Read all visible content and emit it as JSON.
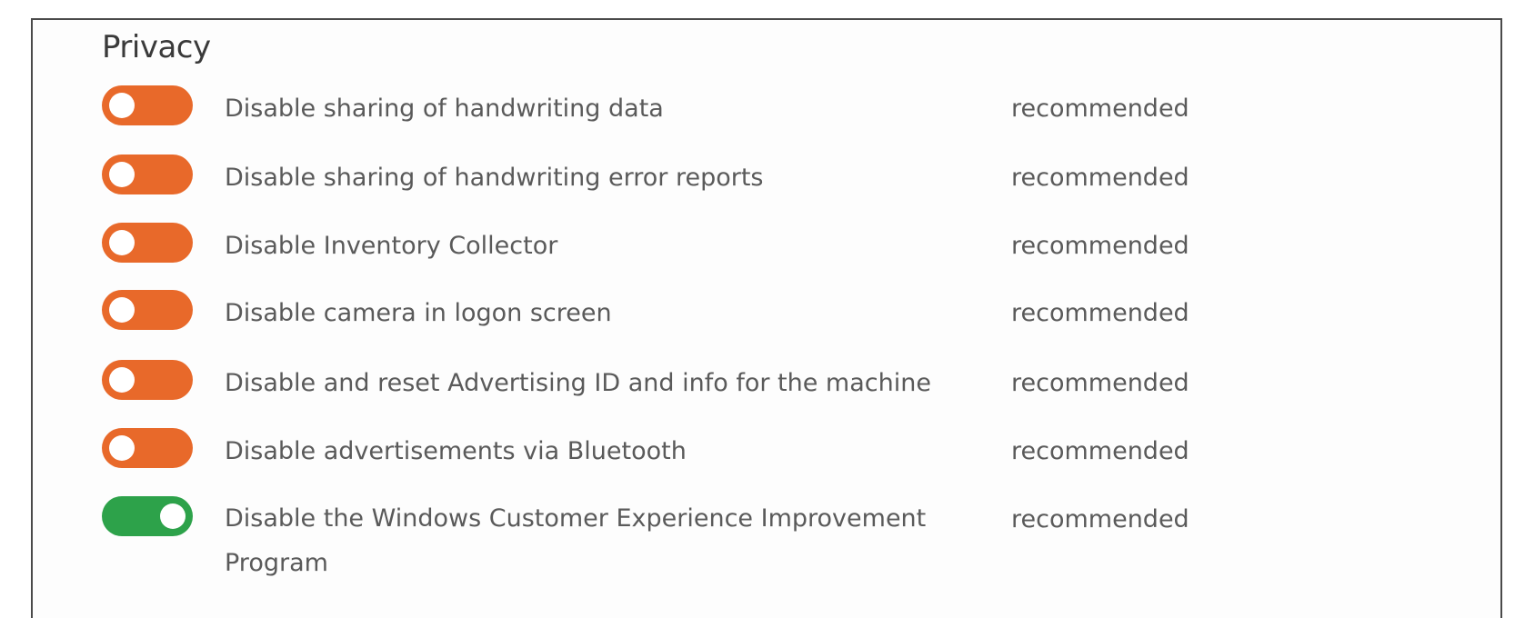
{
  "section": {
    "title": "Privacy"
  },
  "colors": {
    "toggle_off": "#e8692a",
    "toggle_on": "#2da24a",
    "text": "#5a5a5a",
    "border": "#4a4a4a"
  },
  "settings": [
    {
      "label": "Disable sharing of handwriting data",
      "status": "recommended",
      "enabled": false
    },
    {
      "label": "Disable sharing of handwriting error reports",
      "status": "recommended",
      "enabled": false
    },
    {
      "label": "Disable Inventory Collector",
      "status": "recommended",
      "enabled": false
    },
    {
      "label": "Disable camera in logon screen",
      "status": "recommended",
      "enabled": false
    },
    {
      "label": "Disable and reset Advertising ID and info for the machine",
      "status": "recommended",
      "enabled": false
    },
    {
      "label": "Disable advertisements via Bluetooth",
      "status": "recommended",
      "enabled": false
    },
    {
      "label": "Disable the Windows Customer Experience Improvement Program",
      "status": "recommended",
      "enabled": true
    }
  ]
}
